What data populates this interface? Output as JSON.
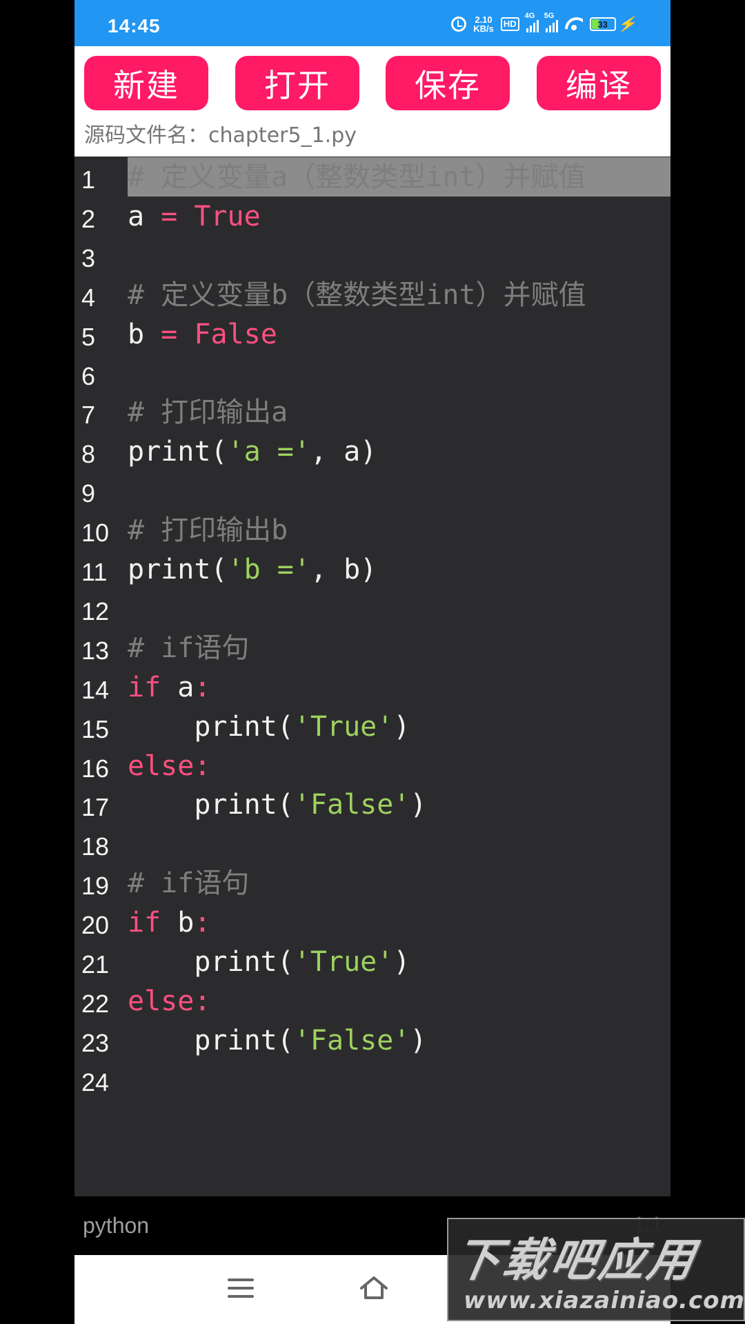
{
  "status_bar": {
    "time": "14:45",
    "net_speed_value": "2.10",
    "net_speed_unit": "KB/s",
    "hd_label": "HD",
    "sim1_label": "4G",
    "sim2_label": "5G",
    "battery_level": "33"
  },
  "toolbar": {
    "new_label": "新建",
    "open_label": "打开",
    "save_label": "保存",
    "compile_label": "编译",
    "filename_prefix": "源码文件名：",
    "filename": "chapter5_1.py"
  },
  "editor": {
    "lines": [
      {
        "n": "1",
        "tokens": [
          {
            "t": "# 定义变量a（整数类型int）并赋值",
            "k": "c"
          }
        ],
        "active": true
      },
      {
        "n": "2",
        "tokens": [
          {
            "t": "a ",
            "k": "p"
          },
          {
            "t": "=",
            "k": "k"
          },
          {
            "t": " ",
            "k": "p"
          },
          {
            "t": "True",
            "k": "k"
          }
        ]
      },
      {
        "n": "3",
        "tokens": []
      },
      {
        "n": "4",
        "tokens": [
          {
            "t": "# 定义变量b（整数类型int）并赋值",
            "k": "c"
          }
        ]
      },
      {
        "n": "5",
        "tokens": [
          {
            "t": "b ",
            "k": "p"
          },
          {
            "t": "=",
            "k": "k"
          },
          {
            "t": " ",
            "k": "p"
          },
          {
            "t": "False",
            "k": "k"
          }
        ]
      },
      {
        "n": "6",
        "tokens": []
      },
      {
        "n": "7",
        "tokens": [
          {
            "t": "# 打印输出a",
            "k": "c"
          }
        ]
      },
      {
        "n": "8",
        "tokens": [
          {
            "t": "print(",
            "k": "p"
          },
          {
            "t": "'a ='",
            "k": "s"
          },
          {
            "t": ", a)",
            "k": "p"
          }
        ]
      },
      {
        "n": "9",
        "tokens": []
      },
      {
        "n": "10",
        "tokens": [
          {
            "t": "# 打印输出b",
            "k": "c"
          }
        ]
      },
      {
        "n": "11",
        "tokens": [
          {
            "t": "print(",
            "k": "p"
          },
          {
            "t": "'b ='",
            "k": "s"
          },
          {
            "t": ", b)",
            "k": "p"
          }
        ]
      },
      {
        "n": "12",
        "tokens": []
      },
      {
        "n": "13",
        "tokens": [
          {
            "t": "# if语句",
            "k": "c"
          }
        ]
      },
      {
        "n": "14",
        "tokens": [
          {
            "t": "if",
            "k": "k"
          },
          {
            "t": " a",
            "k": "p"
          },
          {
            "t": ":",
            "k": "k"
          }
        ]
      },
      {
        "n": "15",
        "tokens": [
          {
            "t": "    print(",
            "k": "p"
          },
          {
            "t": "'True'",
            "k": "s"
          },
          {
            "t": ")",
            "k": "p"
          }
        ]
      },
      {
        "n": "16",
        "tokens": [
          {
            "t": "else:",
            "k": "k"
          }
        ]
      },
      {
        "n": "17",
        "tokens": [
          {
            "t": "    print(",
            "k": "p"
          },
          {
            "t": "'False'",
            "k": "s"
          },
          {
            "t": ")",
            "k": "p"
          }
        ]
      },
      {
        "n": "18",
        "tokens": []
      },
      {
        "n": "19",
        "tokens": [
          {
            "t": "# if语句",
            "k": "c"
          }
        ]
      },
      {
        "n": "20",
        "tokens": [
          {
            "t": "if",
            "k": "k"
          },
          {
            "t": " b",
            "k": "p"
          },
          {
            "t": ":",
            "k": "k"
          }
        ]
      },
      {
        "n": "21",
        "tokens": [
          {
            "t": "    print(",
            "k": "p"
          },
          {
            "t": "'True'",
            "k": "s"
          },
          {
            "t": ")",
            "k": "p"
          }
        ]
      },
      {
        "n": "22",
        "tokens": [
          {
            "t": "else:",
            "k": "k"
          }
        ]
      },
      {
        "n": "23",
        "tokens": [
          {
            "t": "    print(",
            "k": "p"
          },
          {
            "t": "'False'",
            "k": "s"
          },
          {
            "t": ")",
            "k": "p"
          }
        ]
      },
      {
        "n": "24",
        "tokens": []
      }
    ]
  },
  "info_bar": {
    "language": "python",
    "cursor_position": "1:1"
  },
  "watermark": {
    "logo_text": "下载吧应用",
    "url": "www.xiazainiao.com"
  },
  "colors": {
    "status_bar": "#2196f3",
    "button": "#ff1a66",
    "editor_bg": "#2b2b2d",
    "keyword": "#ff4f80",
    "string": "#9ed160",
    "comment": "#7e7e7e"
  }
}
